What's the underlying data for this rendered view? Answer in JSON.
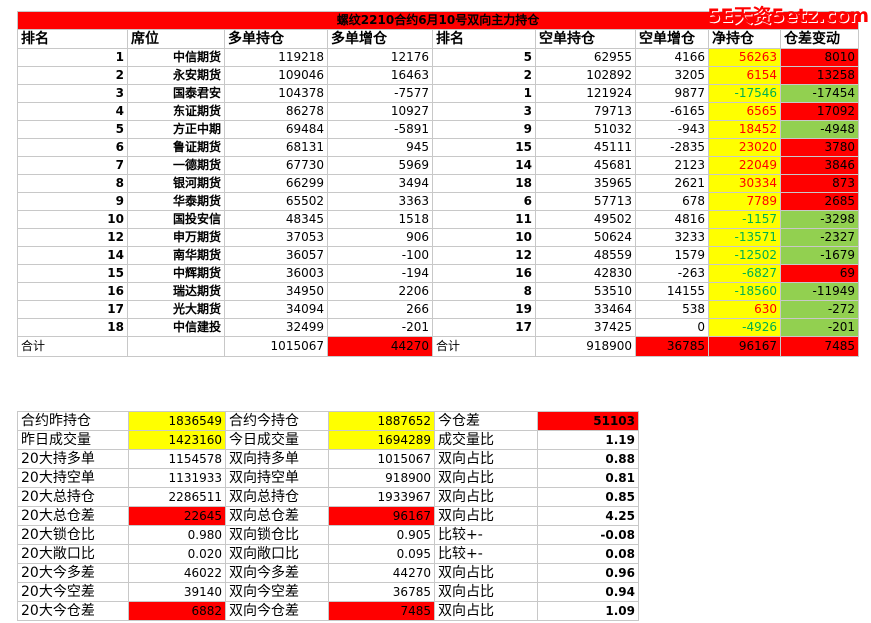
{
  "watermark": "5E天资5etz.com",
  "title": "螺纹2210合约6月10号双向主力持仓",
  "headers": [
    "排名",
    "席位",
    "多单持仓",
    "多单增仓",
    "排名",
    "空单持仓",
    "空单增仓",
    "净持仓",
    "仓差变动"
  ],
  "rows": [
    {
      "rank": "1",
      "seat": "中信期货",
      "long": "119218",
      "long_chg": "12176",
      "srank": "5",
      "short": "62955",
      "short_chg": "4166",
      "net": "56263",
      "diff": "8010"
    },
    {
      "rank": "2",
      "seat": "永安期货",
      "long": "109046",
      "long_chg": "16463",
      "srank": "2",
      "short": "102892",
      "short_chg": "3205",
      "net": "6154",
      "diff": "13258"
    },
    {
      "rank": "3",
      "seat": "国泰君安",
      "long": "104378",
      "long_chg": "-7577",
      "srank": "1",
      "short": "121924",
      "short_chg": "9877",
      "net": "-17546",
      "diff": "-17454"
    },
    {
      "rank": "4",
      "seat": "东证期货",
      "long": "86278",
      "long_chg": "10927",
      "srank": "3",
      "short": "79713",
      "short_chg": "-6165",
      "net": "6565",
      "diff": "17092"
    },
    {
      "rank": "5",
      "seat": "方正中期",
      "long": "69484",
      "long_chg": "-5891",
      "srank": "9",
      "short": "51032",
      "short_chg": "-943",
      "net": "18452",
      "diff": "-4948"
    },
    {
      "rank": "6",
      "seat": "鲁证期货",
      "long": "68131",
      "long_chg": "945",
      "srank": "15",
      "short": "45111",
      "short_chg": "-2835",
      "net": "23020",
      "diff": "3780"
    },
    {
      "rank": "7",
      "seat": "一德期货",
      "long": "67730",
      "long_chg": "5969",
      "srank": "14",
      "short": "45681",
      "short_chg": "2123",
      "net": "22049",
      "diff": "3846"
    },
    {
      "rank": "8",
      "seat": "银河期货",
      "long": "66299",
      "long_chg": "3494",
      "srank": "18",
      "short": "35965",
      "short_chg": "2621",
      "net": "30334",
      "diff": "873"
    },
    {
      "rank": "9",
      "seat": "华泰期货",
      "long": "65502",
      "long_chg": "3363",
      "srank": "6",
      "short": "57713",
      "short_chg": "678",
      "net": "7789",
      "diff": "2685"
    },
    {
      "rank": "10",
      "seat": "国投安信",
      "long": "48345",
      "long_chg": "1518",
      "srank": "11",
      "short": "49502",
      "short_chg": "4816",
      "net": "-1157",
      "diff": "-3298"
    },
    {
      "rank": "12",
      "seat": "申万期货",
      "long": "37053",
      "long_chg": "906",
      "srank": "10",
      "short": "50624",
      "short_chg": "3233",
      "net": "-13571",
      "diff": "-2327"
    },
    {
      "rank": "14",
      "seat": "南华期货",
      "long": "36057",
      "long_chg": "-100",
      "srank": "12",
      "short": "48559",
      "short_chg": "1579",
      "net": "-12502",
      "diff": "-1679"
    },
    {
      "rank": "15",
      "seat": "中辉期货",
      "long": "36003",
      "long_chg": "-194",
      "srank": "16",
      "short": "42830",
      "short_chg": "-263",
      "net": "-6827",
      "diff": "69"
    },
    {
      "rank": "16",
      "seat": "瑞达期货",
      "long": "34950",
      "long_chg": "2206",
      "srank": "8",
      "short": "53510",
      "short_chg": "14155",
      "net": "-18560",
      "diff": "-11949"
    },
    {
      "rank": "17",
      "seat": "光大期货",
      "long": "34094",
      "long_chg": "266",
      "srank": "19",
      "short": "33464",
      "short_chg": "538",
      "net": "630",
      "diff": "-272"
    },
    {
      "rank": "18",
      "seat": "中信建投",
      "long": "32499",
      "long_chg": "-201",
      "srank": "17",
      "short": "37425",
      "short_chg": "0",
      "net": "-4926",
      "diff": "-201"
    }
  ],
  "total": {
    "label": "合计",
    "long": "1015067",
    "long_chg": "44270",
    "label2": "合计",
    "short": "918900",
    "short_chg": "36785",
    "net": "96167",
    "diff": "7485"
  },
  "summary": [
    {
      "l1": "合约昨持仓",
      "v1": "1836549",
      "l2": "合约今持仓",
      "v2": "1887652",
      "l3": "今仓差",
      "v3": "51103"
    },
    {
      "l1": "昨日成交量",
      "v1": "1423160",
      "l2": "今日成交量",
      "v2": "1694289",
      "l3": "成交量比",
      "v3": "1.19"
    },
    {
      "l1": "20大持多单",
      "v1": "1154578",
      "l2": "双向持多单",
      "v2": "1015067",
      "l3": "双向占比",
      "v3": "0.88"
    },
    {
      "l1": "20大持空单",
      "v1": "1131933",
      "l2": "双向持空单",
      "v2": "918900",
      "l3": "双向占比",
      "v3": "0.81"
    },
    {
      "l1": "20大总持仓",
      "v1": "2286511",
      "l2": "双向总持仓",
      "v2": "1933967",
      "l3": "双向占比",
      "v3": "0.85"
    },
    {
      "l1": "20大总仓差",
      "v1": "22645",
      "l2": "双向总仓差",
      "v2": "96167",
      "l3": "双向占比",
      "v3": "4.25"
    },
    {
      "l1": "20大锁仓比",
      "v1": "0.980",
      "l2": "双向锁仓比",
      "v2": "0.905",
      "l3": "比较+-",
      "v3": "-0.08"
    },
    {
      "l1": "20大敞口比",
      "v1": "0.020",
      "l2": "双向敞口比",
      "v2": "0.095",
      "l3": "比较+-",
      "v3": "0.08"
    },
    {
      "l1": "20大今多差",
      "v1": "46022",
      "l2": "双向今多差",
      "v2": "44270",
      "l3": "双向占比",
      "v3": "0.96"
    },
    {
      "l1": "20大今空差",
      "v1": "39140",
      "l2": "双向今空差",
      "v2": "36785",
      "l3": "双向占比",
      "v3": "0.94"
    },
    {
      "l1": "20大今仓差",
      "v1": "6882",
      "l2": "双向今仓差",
      "v2": "7485",
      "l3": "双向占比",
      "v3": "1.09"
    }
  ],
  "colors": {
    "red": "#ff0000",
    "yellow": "#ffff00",
    "green": "#92d050",
    "text_red": "#ff0000",
    "text_green": "#00b050"
  }
}
